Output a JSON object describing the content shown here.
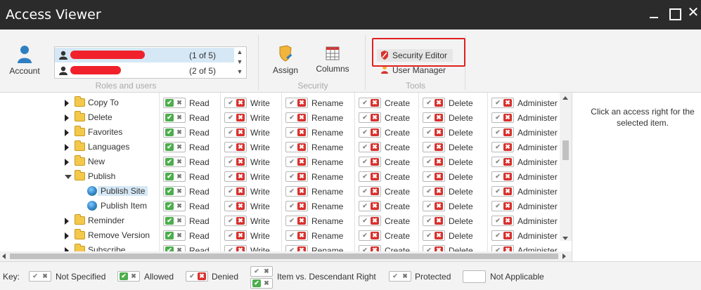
{
  "window": {
    "title": "Access Viewer"
  },
  "ribbon": {
    "account_label": "Account",
    "users": [
      {
        "count": "(1 of 5)",
        "selected": true
      },
      {
        "count": "(2 of 5)",
        "selected": false
      }
    ],
    "roles_group_label": "Roles and users",
    "assign_label": "Assign",
    "columns_label": "Columns",
    "security_group_label": "Security",
    "security_editor_label": "Security Editor",
    "user_manager_label": "User Manager",
    "tools_group_label": "Tools"
  },
  "tree": [
    {
      "label": "Copy To",
      "type": "folder",
      "expanded": false,
      "indent": 1
    },
    {
      "label": "Delete",
      "type": "folder",
      "expanded": false,
      "indent": 1
    },
    {
      "label": "Favorites",
      "type": "folder",
      "expanded": false,
      "indent": 1
    },
    {
      "label": "Languages",
      "type": "folder",
      "expanded": false,
      "indent": 1
    },
    {
      "label": "New",
      "type": "folder",
      "expanded": false,
      "indent": 1
    },
    {
      "label": "Publish",
      "type": "folder",
      "expanded": true,
      "indent": 1
    },
    {
      "label": "Publish Site",
      "type": "item",
      "indent": 2,
      "selected": true
    },
    {
      "label": "Publish Item",
      "type": "item",
      "indent": 2
    },
    {
      "label": "Reminder",
      "type": "folder",
      "expanded": false,
      "indent": 1
    },
    {
      "label": "Remove Version",
      "type": "folder",
      "expanded": false,
      "indent": 1
    },
    {
      "label": "Subscribe",
      "type": "folder",
      "expanded": false,
      "indent": 1
    }
  ],
  "rights_columns": [
    {
      "label": "Read",
      "state": "allowed"
    },
    {
      "label": "Write",
      "state": "denied"
    },
    {
      "label": "Rename",
      "state": "denied"
    },
    {
      "label": "Create",
      "state": "denied"
    },
    {
      "label": "Delete",
      "state": "denied"
    },
    {
      "label": "Administer",
      "state": "denied"
    }
  ],
  "details": {
    "hint": "Click an access right for the selected item."
  },
  "key": {
    "title": "Key:",
    "not_specified": "Not Specified",
    "allowed": "Allowed",
    "denied": "Denied",
    "item_vs_descendant": "Item vs. Descendant Right",
    "protected": "Protected",
    "not_applicable": "Not Applicable"
  },
  "colors": {
    "allowed": "#4cae4c",
    "denied": "#d8322e",
    "highlight": "#e02020",
    "titlebar": "#2b2b2b"
  }
}
